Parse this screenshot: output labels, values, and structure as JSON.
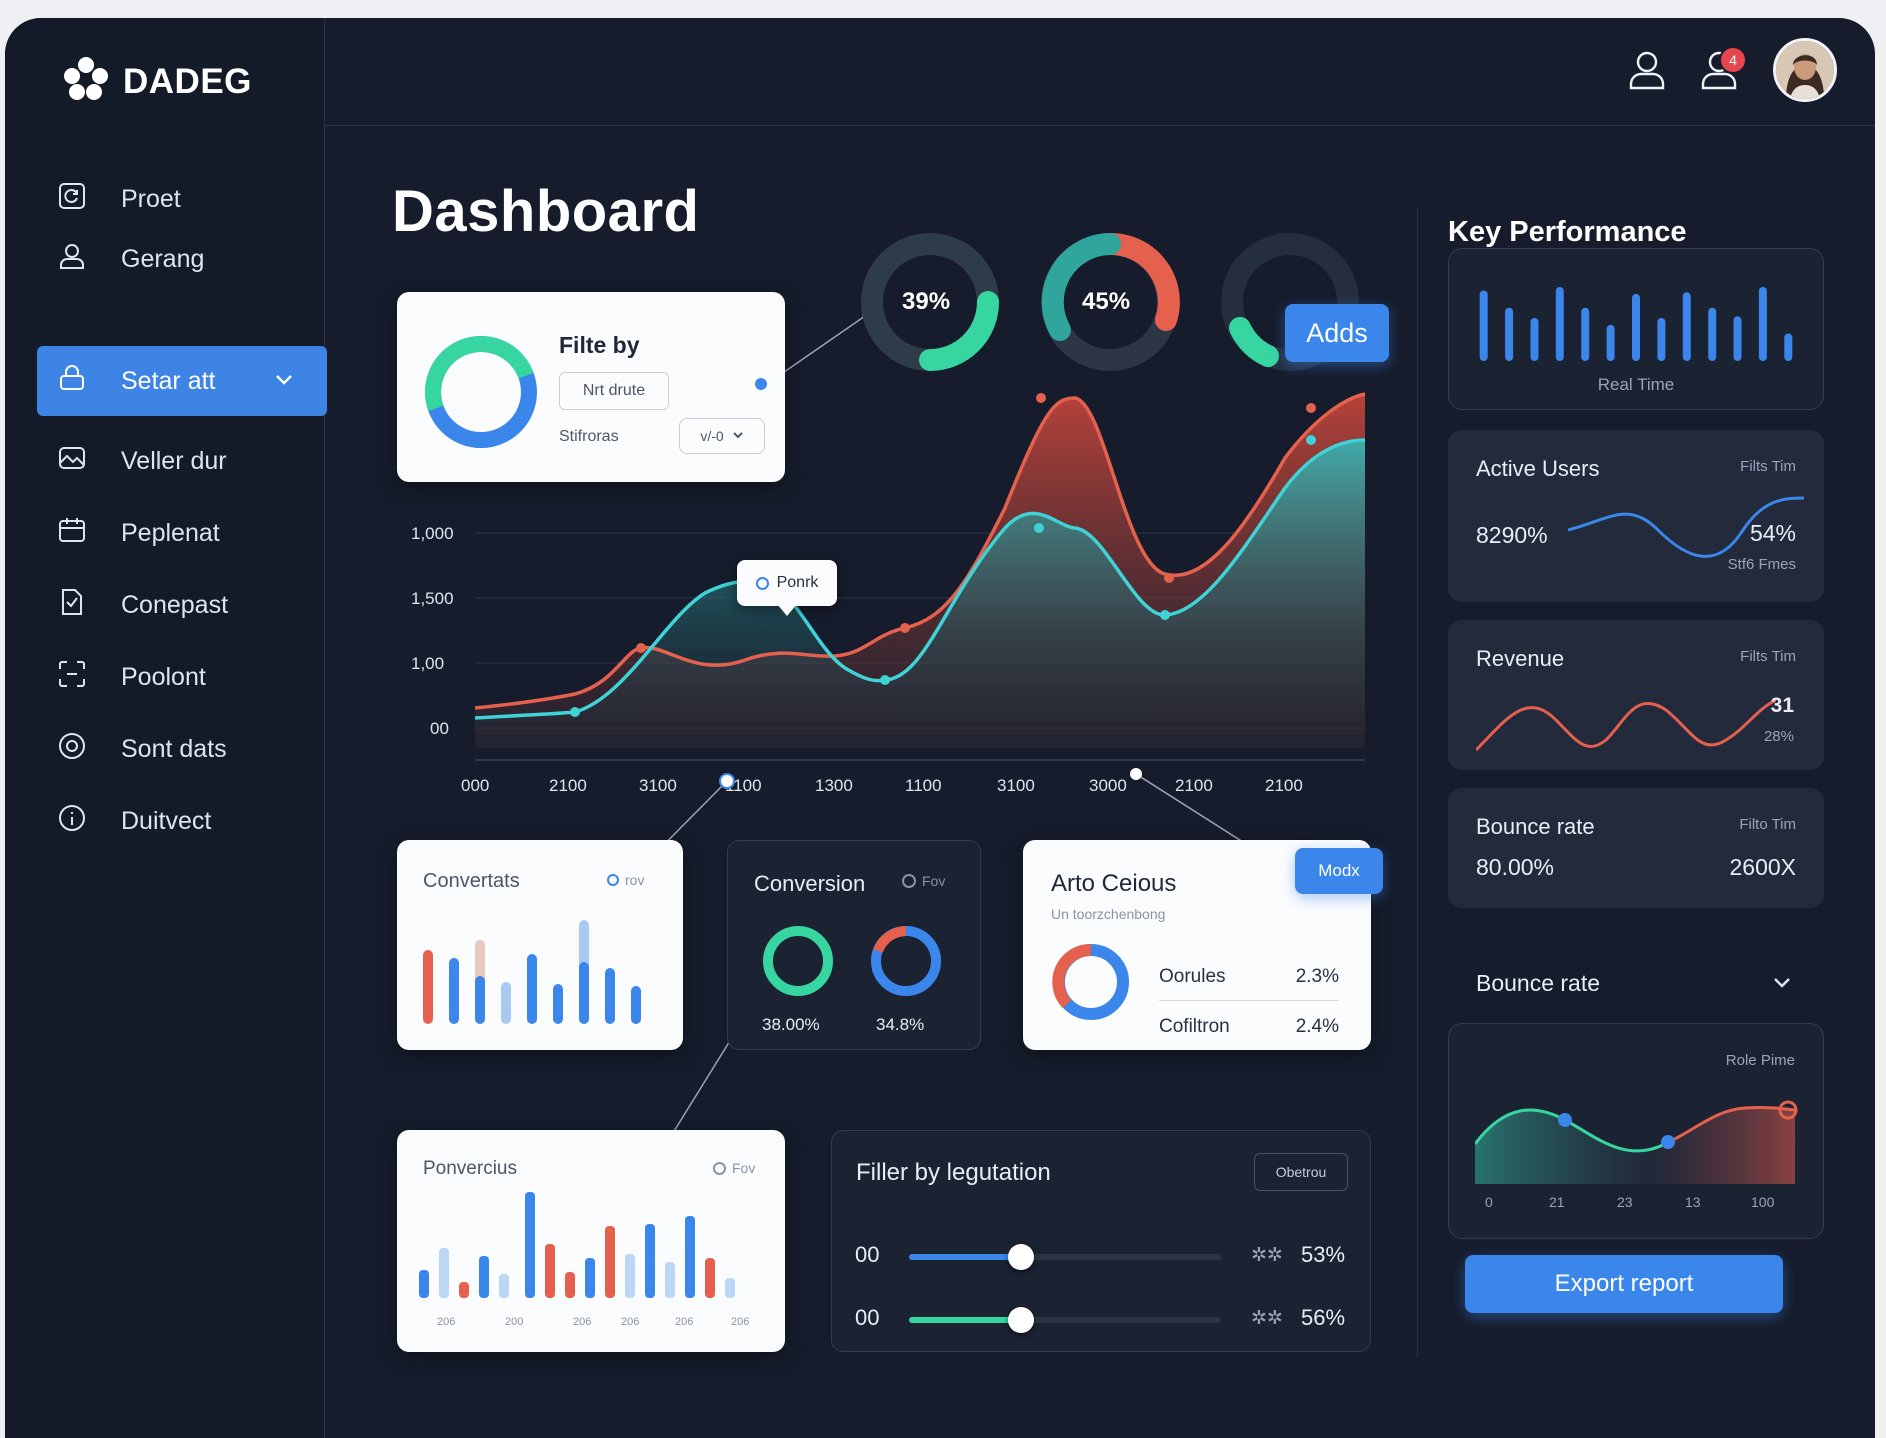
{
  "brand": {
    "name": "DADEG"
  },
  "sidebar": {
    "items": [
      {
        "label": "Proet",
        "icon": "refresh-square-icon"
      },
      {
        "label": "Gerang",
        "icon": "user-icon"
      },
      {
        "label": "Setar att",
        "icon": "lock-icon",
        "active": true
      },
      {
        "label": "Veller dur",
        "icon": "image-icon"
      },
      {
        "label": "Peplenat",
        "icon": "calendar-icon"
      },
      {
        "label": "Conepast",
        "icon": "document-icon"
      },
      {
        "label": "Poolont",
        "icon": "scan-icon"
      },
      {
        "label": "Sont dats",
        "icon": "target-icon"
      },
      {
        "label": "Duitvect",
        "icon": "info-circle-icon"
      }
    ]
  },
  "header": {
    "notification_badge": "4"
  },
  "page": {
    "title": "Dashboard"
  },
  "filter_card": {
    "title": "Filte by",
    "input_value": "Nrt drute",
    "sub_label": "Stifroras",
    "select_value": "v/-0"
  },
  "donuts": [
    {
      "label": "39%",
      "value": 39
    },
    {
      "label": "45%",
      "value": 45
    },
    {
      "label": "",
      "value": 18
    }
  ],
  "add_button": "Adds",
  "tooltip": "Ponrk",
  "main_chart": {
    "y_ticks": [
      "1,000",
      "1,500",
      "1,00",
      "00"
    ],
    "x_ticks": [
      "000",
      "2100",
      "3100",
      "1100",
      "1300",
      "1100",
      "3100",
      "3000",
      "2100",
      "2100"
    ]
  },
  "conversions_card": {
    "title": "Convertats",
    "tag": "rov"
  },
  "conversion_card": {
    "title": "Conversion",
    "tag": "Fov",
    "ring1_label": "38.00%",
    "ring2_label": "34.8%"
  },
  "auto_card": {
    "title": "Arto Ceious",
    "subtitle": "Un toorzchenbong",
    "badge": "Modx",
    "rows": [
      {
        "label": "Oorules",
        "value": "2.3%"
      },
      {
        "label": "Cofiltron",
        "value": "2.4%"
      }
    ]
  },
  "ponvercius_card": {
    "title": "Ponvercius",
    "tag": "Fov",
    "x_ticks": [
      "206",
      "200",
      "206",
      "206",
      "206",
      "206"
    ]
  },
  "filter_location": {
    "title": "Filler by legutation",
    "button": "Obetrou",
    "rows": [
      {
        "label": "00",
        "icon_text": "✲✲",
        "value": "53%",
        "percent": 36,
        "color": "#3a86ea"
      },
      {
        "label": "00",
        "icon_text": "✲✲",
        "value": "56%",
        "percent": 36,
        "color": "#37d6a0"
      }
    ]
  },
  "key_performance": {
    "title": "Key Performance",
    "realtime_label": "Real Time",
    "bars": [
      0.82,
      0.62,
      0.5,
      0.86,
      0.62,
      0.42,
      0.78,
      0.5,
      0.8,
      0.62,
      0.52,
      0.86,
      0.32
    ],
    "active_users": {
      "title": "Active Users",
      "tag": "Filts Tim",
      "left_value": "8290%",
      "right_value": "54%",
      "right_sub": "Stf6 Fmes"
    },
    "revenue": {
      "title": "Revenue",
      "tag": "Filts Tim",
      "value": "31",
      "sub": "28%"
    },
    "bounce_rate": {
      "title": "Bounce rate",
      "tag": "Filto Tim",
      "left_value": "80.00%",
      "right_value": "2600X"
    },
    "bounce_section": {
      "title": "Bounce rate",
      "tag": "Role Pime",
      "x_ticks": [
        "0",
        "21",
        "23",
        "13",
        "100"
      ]
    },
    "export_button": "Export report"
  },
  "colors": {
    "accent": "#3a86ea",
    "teal": "#35c3c9",
    "coral": "#e5614e",
    "green": "#37d6a0",
    "bg": "#161c2b"
  }
}
